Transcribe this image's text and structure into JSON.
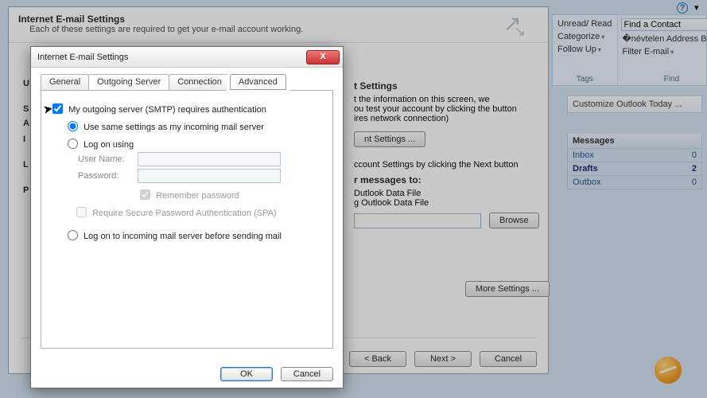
{
  "ribbon": {
    "help": "?",
    "tags_group": "Tags",
    "find_group": "Find",
    "unread_read": "Unread/ Read",
    "categorize": "Categorize",
    "follow_up": "Follow Up",
    "find_contact": "Find a Contact",
    "address_book": "Address Book",
    "filter_email": "Filter E-mail"
  },
  "today": {
    "title": "Customize Outlook Today ...",
    "messages_header": "Messages",
    "rows": [
      {
        "label": "Inbox",
        "count": "0"
      },
      {
        "label": "Drafts",
        "count": "2"
      },
      {
        "label": "Outbox",
        "count": "0"
      }
    ]
  },
  "wizard": {
    "title": "Internet E-mail Settings",
    "subtitle": "Each of these settings are required to get your e-mail account working.",
    "left_letters": [
      "U",
      "S",
      "A",
      "I",
      "L",
      "P"
    ],
    "test_heading": "t Settings",
    "test_lines": [
      "t the information on this screen, we",
      "ou test your account by clicking the button",
      "ires network connection)"
    ],
    "test_btn": "nt Settings ...",
    "test_next_line": "ccount Settings by clicking the Next button",
    "deliver_heading": "r messages to:",
    "deliver_opt1": "Dutlook Data File",
    "deliver_opt2": "g Outlook Data File",
    "browse": "Browse",
    "more_settings": "More Settings ...",
    "back": "< Back",
    "next": "Next >",
    "cancel": "Cancel"
  },
  "modal": {
    "title": "Internet E-mail Settings",
    "tabs": {
      "general": "General",
      "outgoing": "Outgoing Server",
      "connection": "Connection",
      "advanced": "Advanced"
    },
    "smtp_auth": "My outgoing server (SMTP) requires authentication",
    "use_same": "Use same settings as my incoming mail server",
    "log_on": "Log on using",
    "user_name": "User Name:",
    "password": "Password:",
    "remember": "Remember password",
    "require_spa": "Require Secure Password Authentication (SPA)",
    "log_on_incoming": "Log on to incoming mail server before sending mail",
    "ok": "OK",
    "cancel": "Cancel"
  }
}
